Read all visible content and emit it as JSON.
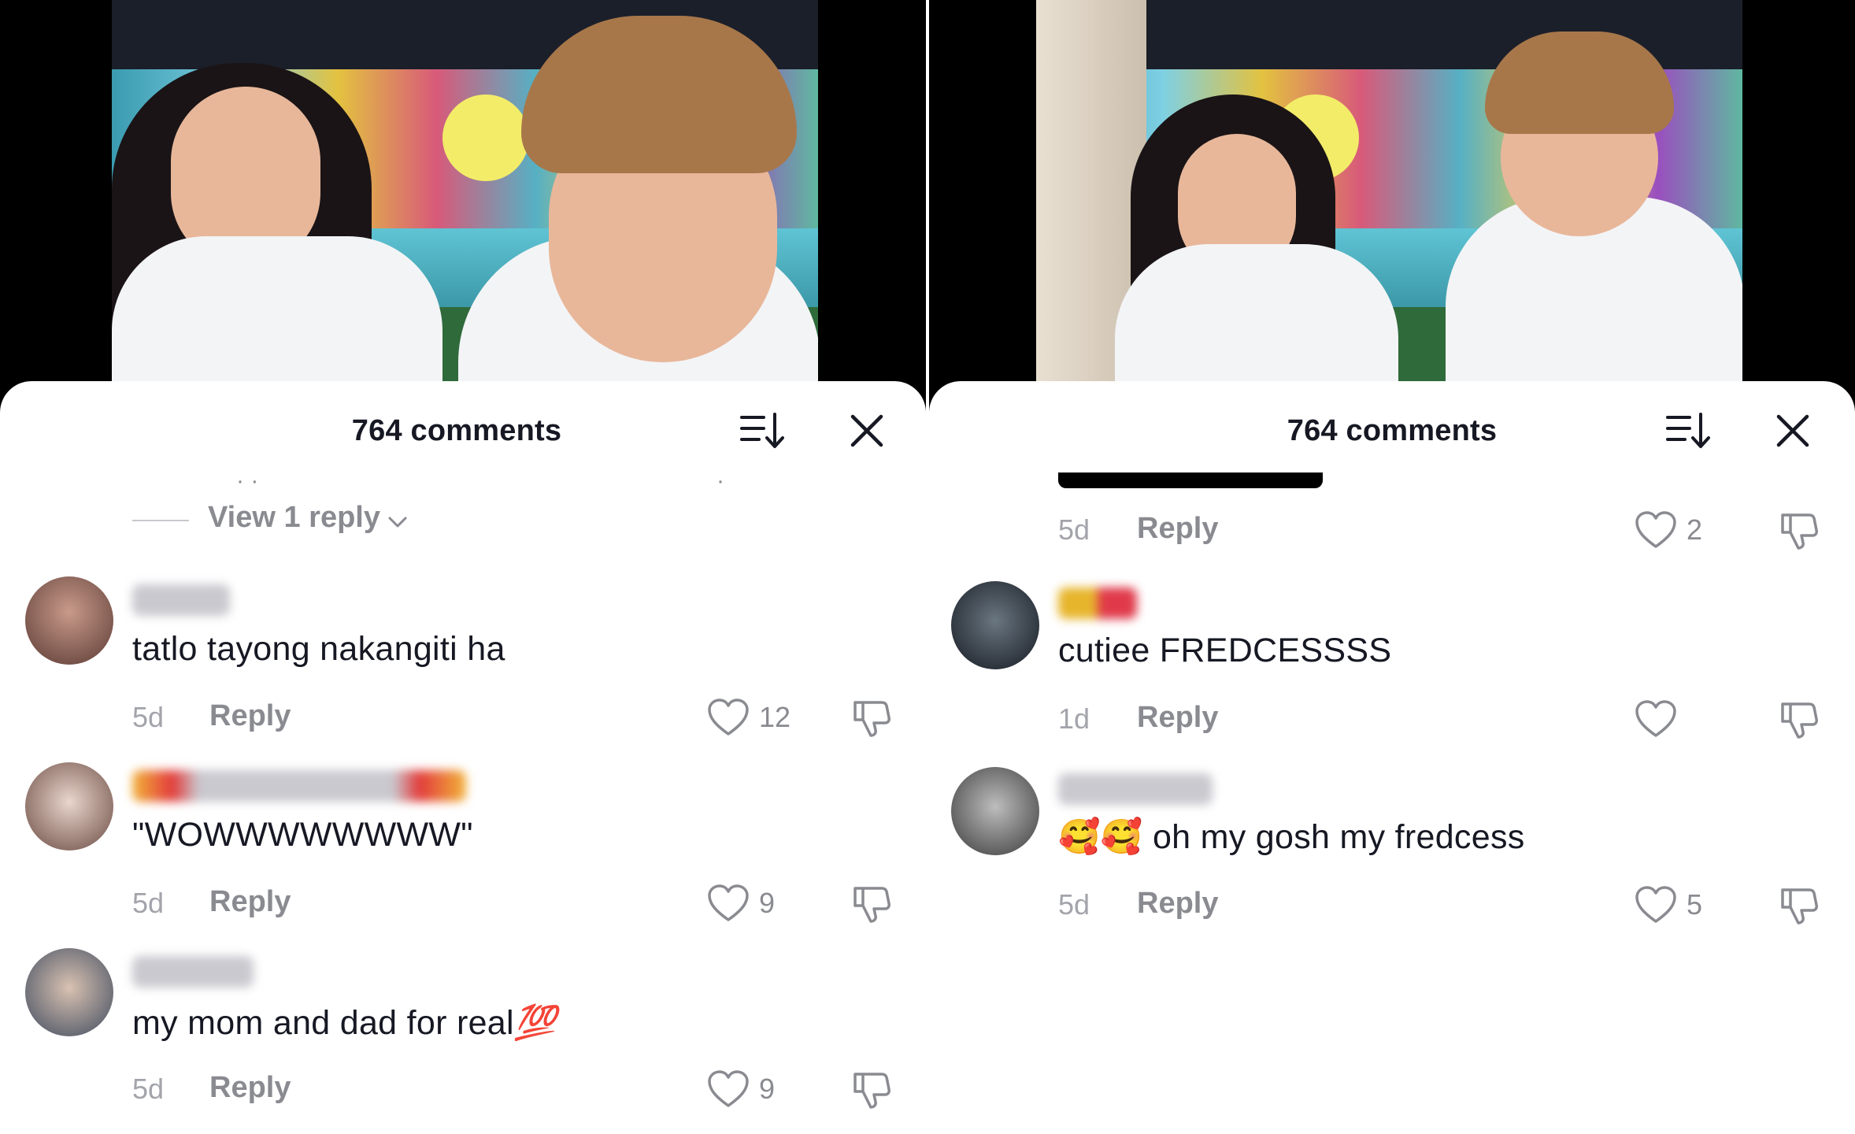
{
  "panels": [
    {
      "header": {
        "title": "764 comments"
      },
      "view_reply": {
        "label": "View 1 reply"
      },
      "comments": [
        {
          "text": "tatlo tayong nakangiti ha",
          "time": "5d",
          "reply": "Reply",
          "likes": "12"
        },
        {
          "text": "\"WOWWWWWWWW\"",
          "time": "5d",
          "reply": "Reply",
          "likes": "9"
        },
        {
          "text": "my mom and dad for real",
          "emoji": "💯",
          "time": "5d",
          "reply": "Reply",
          "likes": "9"
        }
      ]
    },
    {
      "header": {
        "title": "764 comments"
      },
      "top_meta": {
        "time": "5d",
        "reply": "Reply",
        "likes": "2"
      },
      "comments": [
        {
          "text": "cutiee FREDCESSSS",
          "time": "1d",
          "reply": "Reply",
          "likes": ""
        },
        {
          "emoji": "🥰🥰",
          "text": "oh my gosh my fredcess",
          "time": "5d",
          "reply": "Reply",
          "likes": "5"
        }
      ]
    }
  ],
  "icons": {
    "sort": "sort-icon",
    "close": "close-icon",
    "like": "heart-outline-icon",
    "dislike": "thumbs-down-icon",
    "expand": "chevron-down-icon"
  },
  "colors": {
    "text_primary": "#161823",
    "text_secondary": "#8a8b91",
    "text_tertiary": "#a3a4ab",
    "sheet_bg": "#ffffff"
  }
}
